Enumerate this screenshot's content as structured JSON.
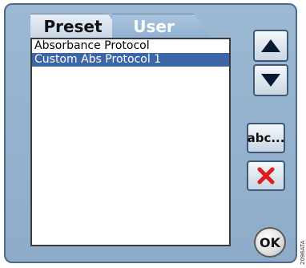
{
  "tabs": [
    {
      "label": "Preset",
      "active": false
    },
    {
      "label": "User",
      "active": true
    }
  ],
  "protocol_list": {
    "items": [
      {
        "label": "Absorbance Protocol",
        "selected": false
      },
      {
        "label": "Custom Abs Protocol 1",
        "selected": true
      }
    ]
  },
  "buttons": {
    "up_icon": "up-arrow-icon",
    "down_icon": "down-arrow-icon",
    "rename_label": "abc...",
    "delete_icon": "red-x-icon",
    "ok_label": "OK"
  },
  "side_label": "2096ATA",
  "colors": {
    "panel": "#9cb8d2",
    "selection": "#3c66a7",
    "delete_red": "#e01b1b"
  }
}
